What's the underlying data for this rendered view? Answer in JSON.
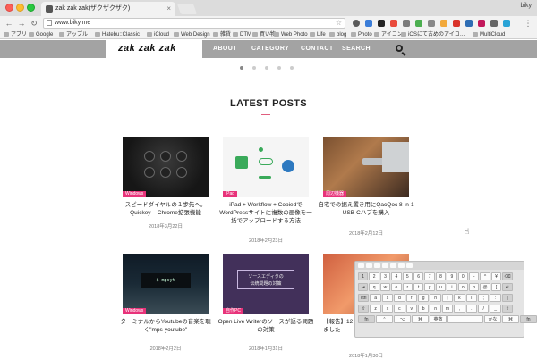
{
  "browser": {
    "tab_title": "zak zak zak(ザクザクザク)",
    "url": "www.biky.me",
    "profile": "biky",
    "bookmarks": [
      "アプリ",
      "Google",
      "アップル",
      "Hatebu::Classic",
      "iCloud",
      "Web Design",
      "雑貨",
      "DTM",
      "買い物",
      "Web Photo",
      "Life",
      "blog",
      "Photo",
      "アイコン",
      "iOSにて古めのアイコ…",
      "MultiCloud"
    ]
  },
  "site": {
    "logo": "zak zak zak",
    "nav": [
      "ABOUT",
      "CATEGORY",
      "CONTACT",
      "SEARCH"
    ],
    "section_title": "LATEST POSTS"
  },
  "posts": [
    {
      "badge": "Windows",
      "title": "スピードダイヤルの１歩先へ。Quickey – Chrome拡張機能",
      "date": "2018年3月22日"
    },
    {
      "badge": "iPad",
      "title": "iPad + Workflow + CopiedでWordPressサイトに複数の画像を一括でアップロードする方法",
      "date": "2018年2月23日"
    },
    {
      "badge": "周辺機器",
      "title": "自宅での据え置き用にQacQoc 8-in-1 USB-Cハブを購入",
      "date": "2018年2月12日"
    },
    {
      "badge": "Windows",
      "title": "ターミナルからYoutubeの音楽を聴く\"mps-youtube\"",
      "date": "2018年2月2日"
    },
    {
      "badge": "自作PC",
      "title": "Open Live Writerのソースが語る問題の対策",
      "date": "2018年1月31日",
      "thumb_text": "ソースエディタの\n伝統問題の対策"
    },
    {
      "badge": "",
      "title": "【報告】12…返品して10…買い替えました",
      "date": "2018年1月30日"
    }
  ],
  "thumb_term": "$ mpsyt",
  "keyboard": {
    "row1": [
      "1",
      "2",
      "3",
      "4",
      "5",
      "6",
      "7",
      "8",
      "9",
      "0",
      "-",
      "^",
      "¥",
      "⌫"
    ],
    "row2": [
      "⇥",
      "q",
      "w",
      "e",
      "r",
      "t",
      "y",
      "u",
      "i",
      "o",
      "p",
      "@",
      "[",
      "↵"
    ],
    "row3": [
      "ctrl",
      "a",
      "s",
      "d",
      "f",
      "g",
      "h",
      "j",
      "k",
      "l",
      ";",
      ":",
      "]"
    ],
    "row4": [
      "⇧",
      "z",
      "x",
      "c",
      "v",
      "b",
      "n",
      "m",
      ",",
      ".",
      "/",
      "_",
      "⇧"
    ],
    "row5": [
      "fn",
      "⌃",
      "⌥",
      "⌘",
      "英数",
      "",
      "かな",
      "⌘",
      "fn"
    ]
  }
}
